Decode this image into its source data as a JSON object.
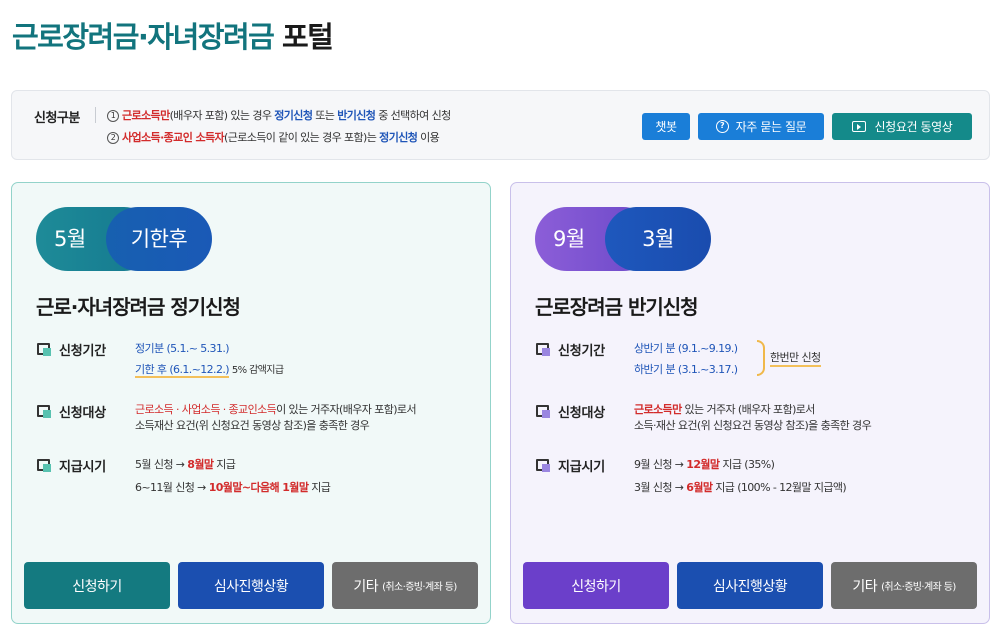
{
  "title": {
    "part1": "근로장려금·자녀장려금",
    "part2": "포털"
  },
  "info": {
    "label": "신청구분",
    "line1": {
      "num": "1",
      "hl1": "근로소득만",
      "t1": "(배우자 포함) 있는 경우 ",
      "hl2": "정기신청",
      "t2": " 또는 ",
      "hl3": "반기신청",
      "t3": " 중 선택하여 신청"
    },
    "line2": {
      "num": "2",
      "hl1": "사업소득·종교인 소득자",
      "t1": "(근로소득이 같이 있는 경우 포함)는 ",
      "hl2": "정기신청",
      "t2": " 이용"
    }
  },
  "top_buttons": {
    "chatbot": "챗봇",
    "faq": "자주 묻는 질문",
    "video": "신청요건 동영상"
  },
  "regular": {
    "pill_a": "5월",
    "pill_b": "기한후",
    "title": "근로·자녀장려금 정기신청",
    "period_label": "신청기간",
    "period_1": "정기분 (5.1.~ 5.31.)",
    "period_2": "기한 후 (6.1.~12.2.)",
    "period_2_note": "5% 감액지급",
    "target_label": "신청대상",
    "target_hl": "근로소득 · 사업소득 · 종교인소득",
    "target_t1": "이 있는 거주자(배우자 포함)로서",
    "target_t2": "소득재산 요건(위 신청요건 동영상 참조)을 충족한 경우",
    "pay_label": "지급시기",
    "pay_1a": "5월 신청 → ",
    "pay_1b": "8월말",
    "pay_1c": " 지급",
    "pay_2a": "6~11월 신청 → ",
    "pay_2b": "10월말~다음해 1월말",
    "pay_2c": " 지급",
    "btn_apply": "신청하기",
    "btn_status": "심사진행상황",
    "btn_other": "기타",
    "btn_other_sub": "(취소·증빙·계좌 등)"
  },
  "half": {
    "pill_a": "9월",
    "pill_b": "3월",
    "title": "근로장려금 반기신청",
    "period_label": "신청기간",
    "period_1": "상반기 분 (9.1.~9.19.)",
    "period_2": "하반기 분 (3.1.~3.17.)",
    "once": "한번만 신청",
    "target_label": "신청대상",
    "target_hl": "근로소득만",
    "target_t1": " 있는 거주자 (배우자 포함)로서",
    "target_t2": "소득·재산 요건(위 신청요건 동영상 참조)을 충족한 경우",
    "pay_label": "지급시기",
    "pay_1a": "9월 신청 → ",
    "pay_1b": "12월말",
    "pay_1c": " 지급 (35%)",
    "pay_2a": "3월 신청 → ",
    "pay_2b": "6월말",
    "pay_2c": " 지급 (100% - 12월말 지급액)",
    "btn_apply": "신청하기",
    "btn_status": "심사진행상황",
    "btn_other": "기타",
    "btn_other_sub": "(취소·증빙·계좌 등)"
  },
  "colors": {
    "teal": "#12747d",
    "blue_button": "#1a7ed8",
    "video_button": "#148a8a",
    "red_highlight": "#d22b2b",
    "blue_highlight": "#1f55b8"
  },
  "icons": [
    "question-icon",
    "play-icon",
    "checkbox-icon"
  ]
}
